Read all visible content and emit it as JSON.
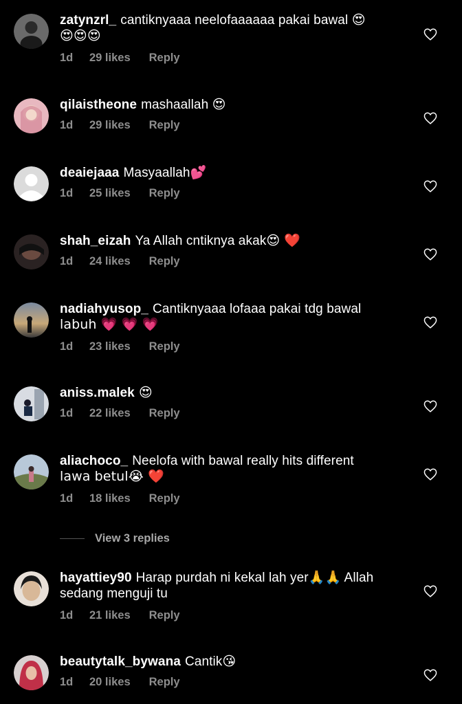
{
  "comments": [
    {
      "username": "zatynzrl_",
      "text": "cantiknyaaa neelofaaaaaa pakai bawal",
      "text2": "😍",
      "line2": "😍😍😍",
      "time": "1d",
      "likes": "29 likes",
      "reply": "Reply",
      "avatar_color": "#5a5a5a"
    },
    {
      "username": "qilaistheone",
      "text": "mashaallah",
      "emoji": "😍",
      "time": "1d",
      "likes": "29 likes",
      "reply": "Reply",
      "avatar_color": "#d9a0a8"
    },
    {
      "username": "deaiejaaa",
      "text": "Masyaallah",
      "emoji": "💕",
      "time": "1d",
      "likes": "25 likes",
      "reply": "Reply",
      "avatar_color": "#dbdbdb"
    },
    {
      "username": "shah_eizah",
      "text": "Ya Allah cntiknya akak",
      "emoji": "😍 ❤️",
      "time": "1d",
      "likes": "24 likes",
      "reply": "Reply",
      "avatar_color": "#3a3030"
    },
    {
      "username": "nadiahyusop_",
      "text": "Cantiknyaaa lofaaa pakai tdg bawal",
      "line2": "labuh 💗 💗 💗",
      "time": "1d",
      "likes": "23 likes",
      "reply": "Reply",
      "avatar_color": "#8a7a6a"
    },
    {
      "username": "aniss.malek",
      "text": "",
      "emoji": "😍",
      "time": "1d",
      "likes": "22 likes",
      "reply": "Reply",
      "avatar_color": "#c8ccd2"
    },
    {
      "username": "aliachoco_",
      "text": "Neelofa with bawal really hits different",
      "line2": "lawa betul😭 ❤️",
      "time": "1d",
      "likes": "18 likes",
      "reply": "Reply",
      "avatar_color": "#7a8a6a"
    },
    {
      "username": "hayattiey90",
      "text": "Harap purdah ni kekal lah yer🙏🙏 Allah",
      "line2": "sedang menguji tu",
      "time": "1d",
      "likes": "21 likes",
      "reply": "Reply",
      "avatar_color": "#c9b6a0"
    },
    {
      "username": "beautytalk_bywana",
      "text": "Cantik",
      "emoji": "😘",
      "time": "1d",
      "likes": "20 likes",
      "reply": "Reply",
      "avatar_color": "#c03a4a"
    }
  ],
  "view_replies_label": "View 3 replies"
}
